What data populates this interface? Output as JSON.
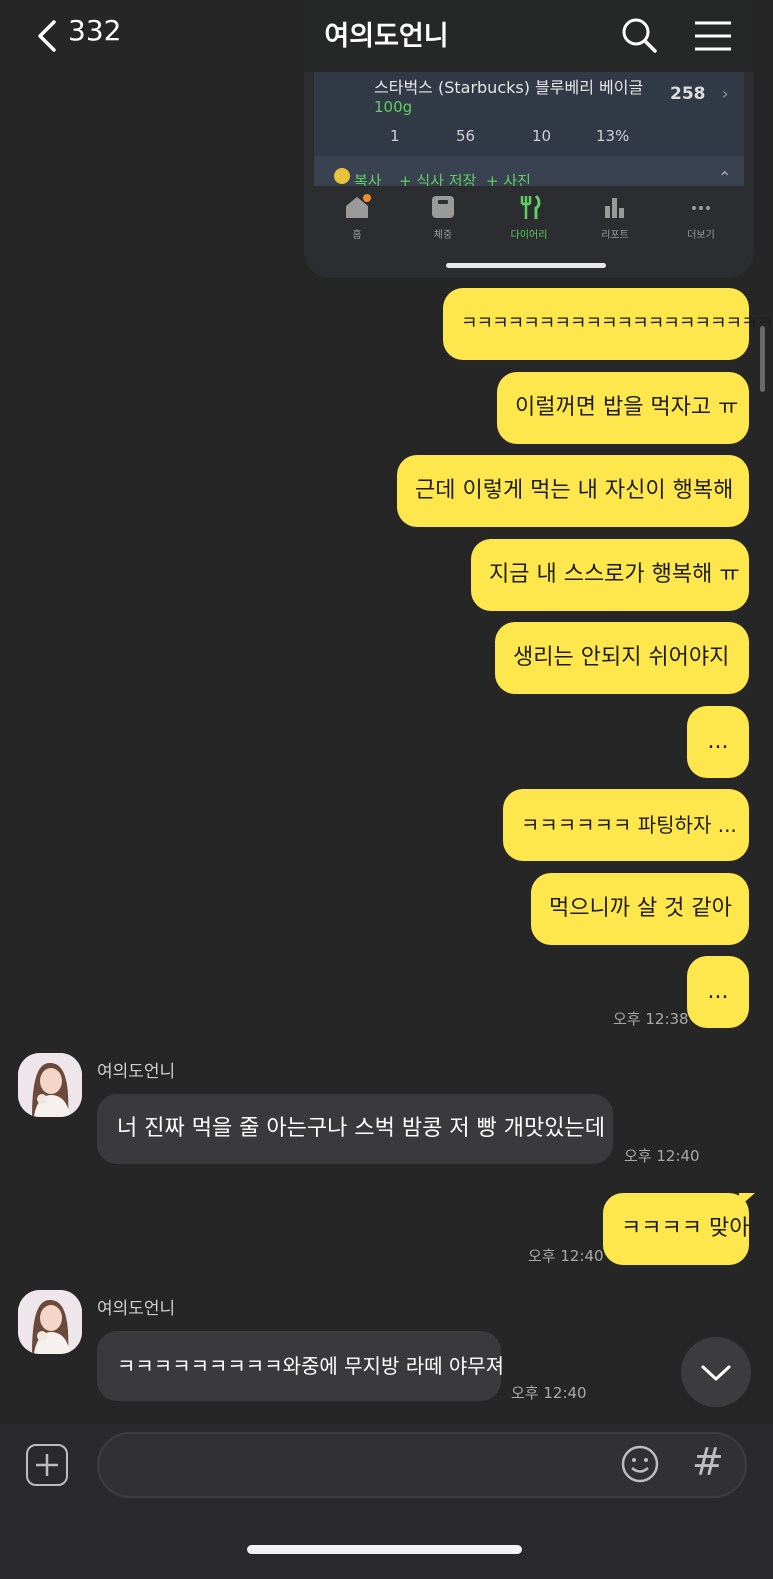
{
  "header": {
    "back_count": "332",
    "title": "여의도언니"
  },
  "embedded_screenshot": {
    "food_name": "스타벅스 (Starbucks) 블루베리 베이글",
    "food_amount": "100g",
    "calories": "258",
    "nutrients": [
      "1",
      "56",
      "10",
      "13%"
    ],
    "actions": [
      "복사",
      "+ 식사 저장",
      "+ 사진"
    ],
    "nav": [
      {
        "label": "홈",
        "icon": "home-icon"
      },
      {
        "label": "체중",
        "icon": "scale-icon"
      },
      {
        "label": "다이어리",
        "icon": "fork-knife-icon",
        "active": true
      },
      {
        "label": "리포트",
        "icon": "bar-chart-icon"
      },
      {
        "label": "더보기",
        "icon": "more-icon"
      }
    ],
    "colors": {
      "accent": "#5fcf5f"
    }
  },
  "messages": {
    "m1": "ㅋㅋㅋㅋㅋㅋㅋㅋㅋㅋㅋㅋㅋㅋㅋㅋㅋㅋㅋㅋㅋ",
    "m2": "이럴꺼면 밥을 먹자고 ㅠ",
    "m3": "근데 이렇게 먹는 내 자신이 행복해",
    "m4": "지금 내 스스로가 행복해 ㅠ",
    "m5": "생리는 안되지 쉬어야지",
    "m6": "...",
    "m7": "ㅋㅋㅋㅋㅋㅋ 파팅하자 ...",
    "m8": "먹으니까 살 것 같아",
    "m9": "...",
    "m9_time": "오후 12:38",
    "o1_sender": "여의도언니",
    "o1": "너 진짜 먹을 줄 아는구나 스벅 밤콩 저 빵 개맛있는데",
    "o1_time": "오후 12:40",
    "m10": "ㅋㅋㅋㅋ 맞아",
    "m10_time": "오후 12:40",
    "o2_sender": "여의도언니",
    "o2": "ㅋㅋㅋㅋㅋㅋㅋㅋㅋ와중에 무지방 라떼 야무져",
    "o2_time": "오후 12:40"
  },
  "colors": {
    "my_bubble": "#fde74c",
    "other_bubble": "#3a3a3c",
    "background": "#262626"
  }
}
